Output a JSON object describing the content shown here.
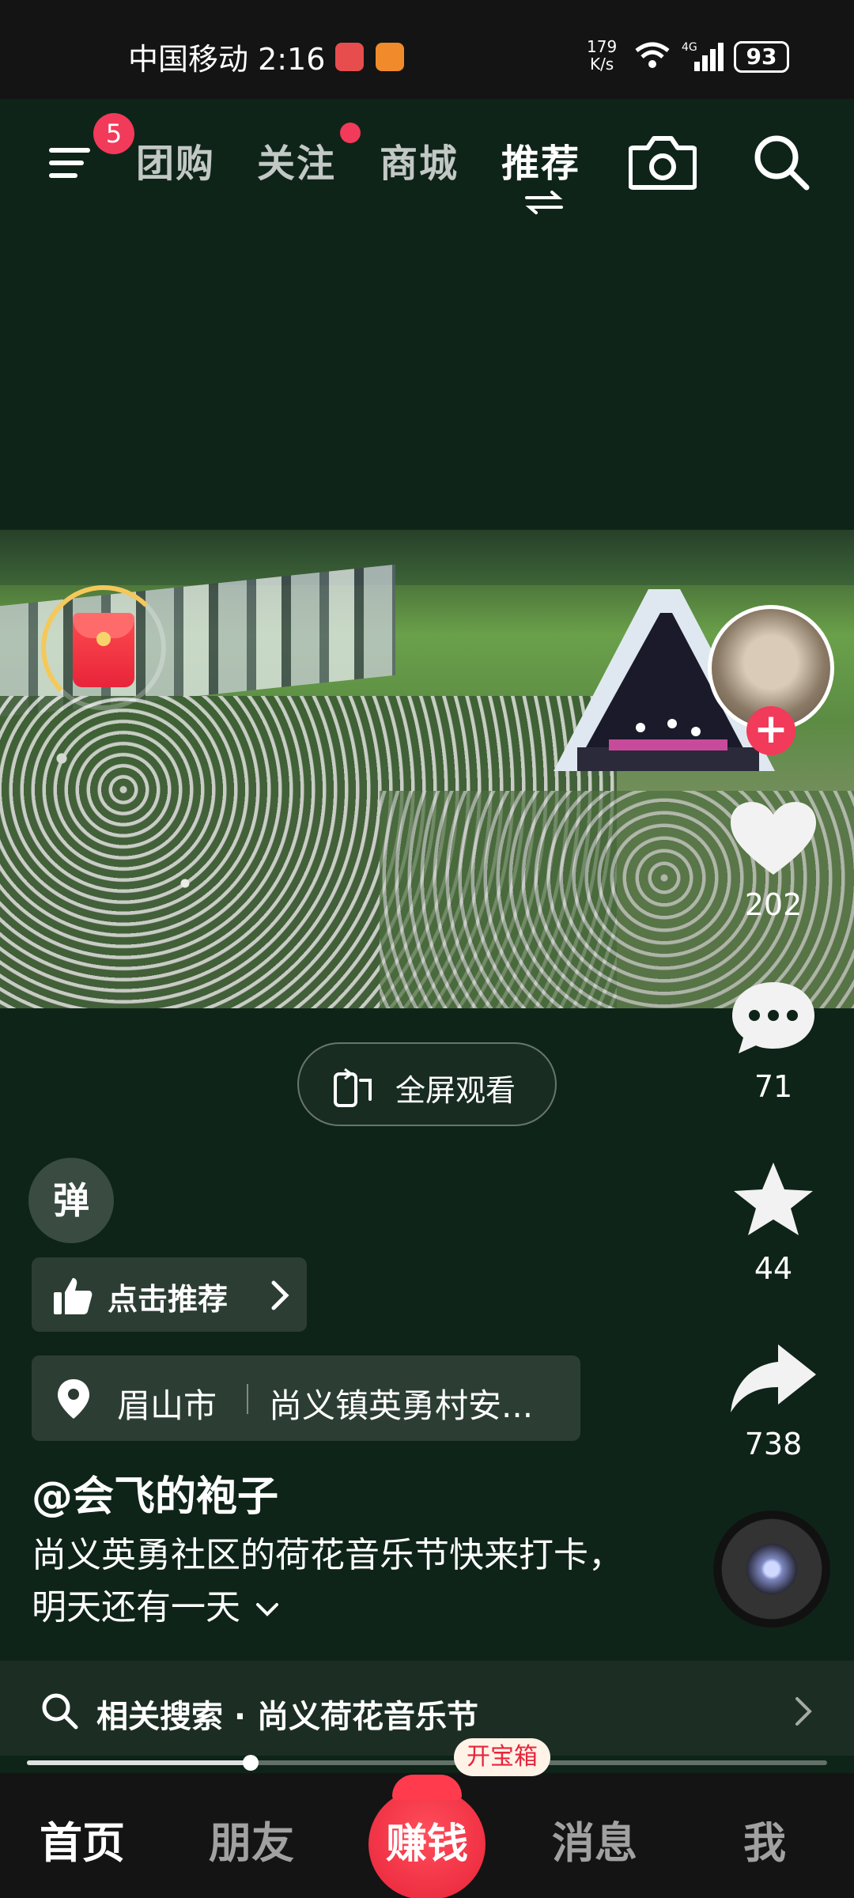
{
  "status_bar": {
    "carrier_time": "中国移动 2:16",
    "net_speed_value": "179",
    "net_speed_unit": "K/s",
    "network": "4G",
    "battery": "93"
  },
  "top_nav": {
    "menu_badge": "5",
    "tabs": [
      {
        "label": "团购"
      },
      {
        "label": "关注"
      },
      {
        "label": "商城"
      },
      {
        "label": "推荐"
      }
    ],
    "icons": [
      "menu-icon",
      "swap-icon",
      "camera-icon",
      "search-icon"
    ]
  },
  "video": {
    "fullscreen_label": "全屏观看",
    "progress_fraction": 0.28
  },
  "right_rail": {
    "likes": "202",
    "comments": "71",
    "favorites": "44",
    "shares": "738"
  },
  "post": {
    "danmaku_label": "弹",
    "recommend_label": "点击推荐",
    "location_city": "眉山市",
    "location_place": "尚义镇英勇村安...",
    "author": "@会飞的袍子",
    "caption": "尚义英勇社区的荷花音乐节快来打卡，明天还有一天"
  },
  "related_search": {
    "label": "相关搜索 · 尚义荷花音乐节"
  },
  "bottom_nav": {
    "home": "首页",
    "friends": "朋友",
    "earn": "赚钱",
    "treasure": "开宝箱",
    "messages": "消息",
    "me": "我"
  },
  "colors": {
    "accent_red": "#f23a5a",
    "background": "#0f2419"
  }
}
